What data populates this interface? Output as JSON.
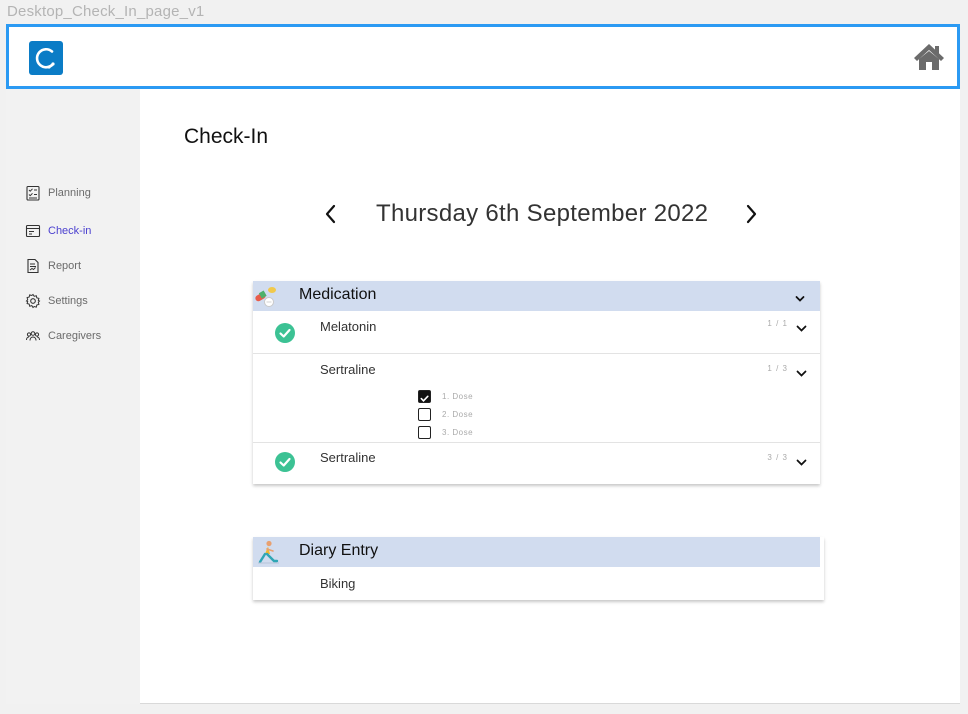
{
  "frame_label": "Desktop_Check_In_page_v1",
  "header": {
    "logo_icon": "app-logo-refresh-icon",
    "home_icon": "home-icon"
  },
  "sidebar": {
    "items": [
      {
        "label": "Planning",
        "icon": "planning-checklist-icon",
        "active": false
      },
      {
        "label": "Check-in",
        "icon": "checkin-card-icon",
        "active": true
      },
      {
        "label": "Report",
        "icon": "report-document-icon",
        "active": false
      },
      {
        "label": "Settings",
        "icon": "gear-icon",
        "active": false
      },
      {
        "label": "Caregivers",
        "icon": "people-group-icon",
        "active": false
      }
    ]
  },
  "page": {
    "title": "Check-In",
    "date": "Thursday 6th September 2022"
  },
  "medication": {
    "title": "Medication",
    "icon": "pills-icon",
    "items": [
      {
        "name": "Melatonin",
        "count": "1 / 1",
        "taken": true
      },
      {
        "name": "Sertraline",
        "count": "1 / 3",
        "taken": false,
        "doses": [
          {
            "label": "1. Dose",
            "checked": true
          },
          {
            "label": "2. Dose",
            "checked": false
          },
          {
            "label": "3. Dose",
            "checked": false
          }
        ]
      },
      {
        "name": "Sertraline",
        "count": "3 / 3",
        "taken": true
      }
    ]
  },
  "diary": {
    "title": "Diary Entry",
    "icon": "exercise-person-icon",
    "entries": [
      "Biking"
    ]
  },
  "colors": {
    "accent_blue": "#2b9af3",
    "logo_blue": "#0b7cc6",
    "card_header": "#d1dcef",
    "check_green": "#3cc294",
    "active_nav": "#4a3fcf"
  }
}
